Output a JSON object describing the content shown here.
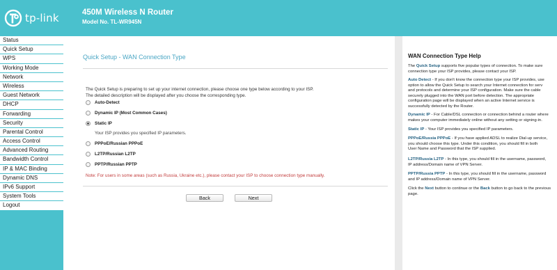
{
  "header": {
    "logo_text": "tp-link",
    "product_title": "450M Wireless N Router",
    "product_model": "Model No. TL-WR945N"
  },
  "sidebar": {
    "items": [
      "Status",
      "Quick Setup",
      "WPS",
      "Working Mode",
      "Network",
      "Wireless",
      "Guest Network",
      "DHCP",
      "Forwarding",
      "Security",
      "Parental Control",
      "Access Control",
      "Advanced Routing",
      "Bandwidth Control",
      "IP & MAC Binding",
      "Dynamic DNS",
      "IPv6 Support",
      "System Tools",
      "Logout"
    ]
  },
  "main": {
    "title": "Quick Setup - WAN Connection Type",
    "intro_line1": "The Quick Setup is preparing to set up your internet connection, please choose one type below according to your ISP.",
    "intro_line2": "The detailed description will be displayed after you choose the corresponding type.",
    "options": [
      {
        "label": "Auto-Detect",
        "selected": false
      },
      {
        "label": "Dynamic IP (Most Common Cases)",
        "selected": false
      },
      {
        "label": "Static IP",
        "selected": true
      },
      {
        "label": "PPPoE/Russian PPPoE",
        "selected": false
      },
      {
        "label": "L2TP/Russian L2TP",
        "selected": false
      },
      {
        "label": "PPTP/Russian PPTP",
        "selected": false
      }
    ],
    "selected_description": "Your ISP provides you specified IP parameters.",
    "note": "Note: For users in some areas (such as Russia, Ukraine etc.), please contact your ISP to choose connection type manually.",
    "back_label": "Back",
    "next_label": "Next"
  },
  "help": {
    "title": "WAN Connection Type Help",
    "p1_pre": "The ",
    "p1_term": "Quick Setup",
    "p1_rest": " supports five popular types of connection. To make sure",
    "p1_line2": "connection type your ISP provides, please contact your ISP.",
    "p2_term": "Auto Detect",
    "p2_l1": " - If you don't know the connection type your ISP provides, use",
    "p2_l2": "option to allow the Quick Setup to search your Internet connection for serv",
    "p2_l3": "and protocols and determine your ISP configuration. Make sure the cable",
    "p2_l4": "securely plugged into the WAN port before detection. The appropriate",
    "p2_l5": "configuration page will be displayed when an active Internet service is",
    "p2_l6": "successfully detected by the Router.",
    "p3_term": "Dynamic IP",
    "p3_l1": " - For Cable/DSL connection or connection behind a router where",
    "p3_l2": "makes your computer immediately online without any setting or signing-in.",
    "p4_term": "Static IP",
    "p4_l1": " - Your ISP provides you specified IP parameters.",
    "p5_term": "PPPoE/Russia PPPoE",
    "p5_l1": " - If you have applied ADSL to realize Dial-up service,",
    "p5_l2": "you should choose this type. Under this condition, you should fill in both",
    "p5_l3": "User Name and Password that the ISP supplied.",
    "p6_term": "L2TP/Russia L2TP",
    "p6_l1": " - In this type, you should fill in the username, password,",
    "p6_l2": "IP address/Domain name of VPN Server.",
    "p7_term": "PPTP/Russia PPTP",
    "p7_l1": " - In this type, you should fill in the username, password",
    "p7_l2": "and IP address/Domain name of VPN Server.",
    "p8_pre": "Click the ",
    "p8_next": "Next",
    "p8_mid": " button to continue or the ",
    "p8_back": "Back",
    "p8_post": " button to go back to the previous",
    "p8_l2": "page."
  }
}
